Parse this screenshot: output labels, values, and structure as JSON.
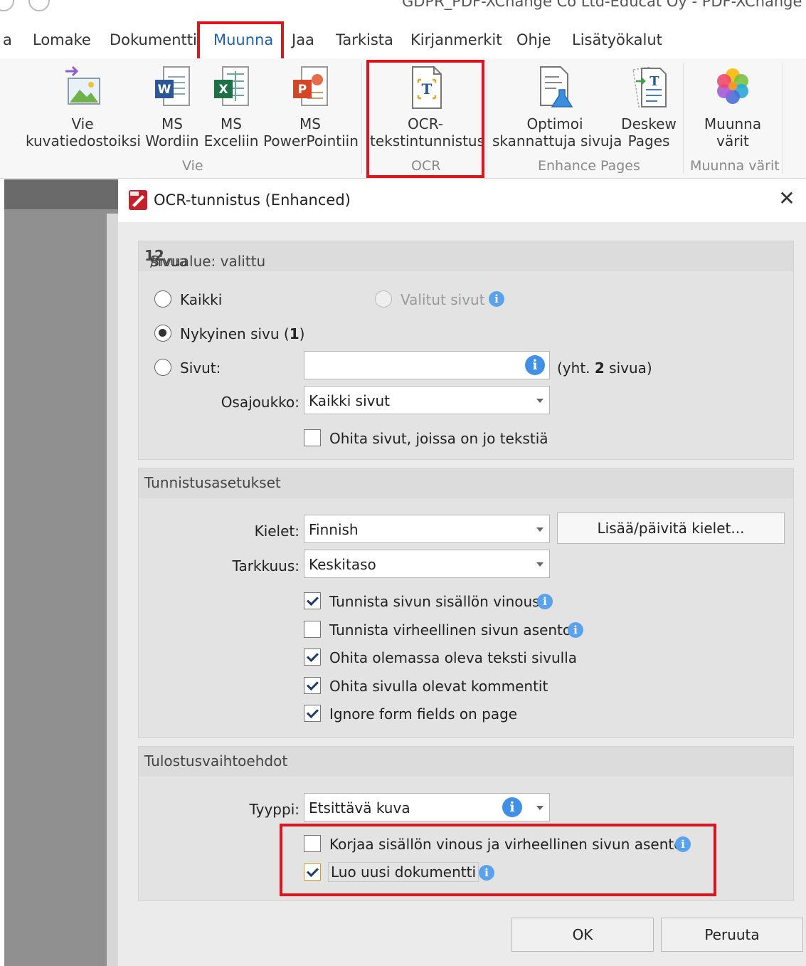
{
  "window": {
    "title": "GDPR_PDF-XChange Co Ltd-Educat Oy - PDF-XChange Edi"
  },
  "menu": {
    "partial_left": "a",
    "tabs": [
      "Lomake",
      "Dokumentti",
      "Muunna",
      "Jaa",
      "Tarkista",
      "Kirjanmerkit",
      "Ohje",
      "Lisätyökalut"
    ],
    "active_tab": "Muunna"
  },
  "ribbon": {
    "vie_kuvatiedostoiksi": {
      "line1": "Vie",
      "line2": "kuvatiedostoiksi"
    },
    "ms_wordiin": {
      "line1": "MS",
      "line2": "Wordiin"
    },
    "ms_exceliin": {
      "line1": "MS",
      "line2": "Exceliin"
    },
    "ms_powerpointiin": {
      "line1": "MS",
      "line2": "PowerPointiin"
    },
    "ocr": {
      "line1": "OCR-",
      "line2": "tekstintunnistus"
    },
    "optimoi": {
      "line1": "Optimoi",
      "line2": "skannattuja sivuja"
    },
    "deskew": {
      "line1": "Deskew",
      "line2": "Pages"
    },
    "muunna_varit": {
      "line1": "Muunna",
      "line2": "värit"
    },
    "groups": {
      "vie": "Vie",
      "ocr": "OCR",
      "enhance": "Enhance Pages",
      "muunna_varit": "Muunna värit"
    }
  },
  "dialog": {
    "title": "OCR-tunnistus (Enhanced)",
    "close_glyph": "✕",
    "page_range": {
      "header_prefix": "Sivualue: valittu ",
      "header_selected": "1",
      "header_sep": " / ",
      "header_total": "2",
      "header_suffix": " sivua",
      "all_label": "Kaikki",
      "selected_pages_label": "Valitut sivut",
      "current_page_prefix": "Nykyinen sivu (",
      "current_page_num": "1",
      "current_page_suffix": ")",
      "pages_label": "Sivut:",
      "pages_value": "",
      "total_prefix": "(yht. ",
      "total_num": "2",
      "total_suffix": " sivua)",
      "subset_label": "Osajoukko:",
      "subset_value": "Kaikki sivut",
      "skip_text_pages_label": "Ohita sivut, joissa on jo tekstiä",
      "selected_option": "Nykyinen sivu",
      "skip_text_pages_checked": false
    },
    "recognition": {
      "header": "Tunnistusasetukset",
      "languages_label": "Kielet:",
      "languages_value": "Finnish",
      "add_languages_button": "Lisää/päivitä kielet...",
      "accuracy_label": "Tarkkuus:",
      "accuracy_value": "Keskitaso",
      "options": [
        {
          "label": "Tunnista sivun sisällön vinous",
          "checked": true
        },
        {
          "label": "Tunnista virheellinen sivun asento",
          "checked": false
        },
        {
          "label": "Ohita olemassa oleva teksti sivulla",
          "checked": true
        },
        {
          "label": "Ohita sivulla olevat kommentit",
          "checked": true
        },
        {
          "label": "Ignore form fields on page",
          "checked": true
        }
      ]
    },
    "output": {
      "header": "Tulostusvaihtoehdot",
      "type_label": "Tyyppi:",
      "type_value": "Etsittävä kuva",
      "fix_skew_label": "Korjaa sisällön vinous ja virheellinen sivun asento",
      "fix_skew_checked": false,
      "new_document_label": "Luo uusi dokumentti",
      "new_document_checked": true
    },
    "ok_button": "OK",
    "cancel_button": "Peruuta",
    "info_glyph": "i"
  },
  "colors": {
    "highlight": "#e0141e",
    "active_tab": "#1f5fb0",
    "info": "#5aa2ec"
  }
}
